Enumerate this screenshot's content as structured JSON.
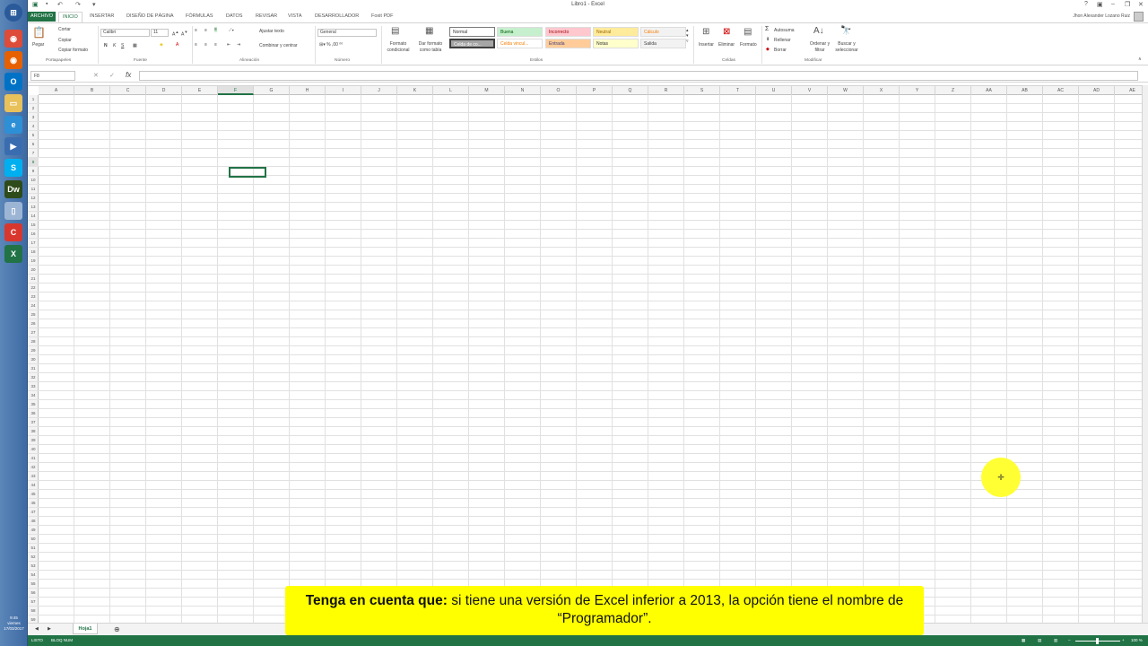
{
  "window": {
    "title": "Libro1 - Excel",
    "user": "Jhon Alexander Lozano Ruiz"
  },
  "tabs": [
    {
      "label": "ARCHIVO"
    },
    {
      "label": "INICIO"
    },
    {
      "label": "INSERTAR"
    },
    {
      "label": "DISEÑO DE PÁGINA"
    },
    {
      "label": "FÓRMULAS"
    },
    {
      "label": "DATOS"
    },
    {
      "label": "REVISAR"
    },
    {
      "label": "VISTA"
    },
    {
      "label": "DESARROLLADOR"
    },
    {
      "label": "Foxit PDF"
    }
  ],
  "ribbon": {
    "clipboard": {
      "paste": "Pegar",
      "cut": "Cortar",
      "copy": "Copiar",
      "format_painter": "Copiar formato",
      "label": "Portapapeles"
    },
    "font": {
      "name": "Calibri",
      "size": "11",
      "bold": "N",
      "italic": "K",
      "underline": "S",
      "label": "Fuente"
    },
    "alignment": {
      "wrap": "Ajustar texto",
      "merge": "Combinar y centrar",
      "label": "Alineación"
    },
    "number": {
      "format": "General",
      "label": "Número"
    },
    "styles": {
      "conditional": "Formato condicional",
      "as_table": "Dar formato como tabla",
      "cells": [
        {
          "label": "Normal",
          "bg": "#ffffff",
          "fg": "#333333"
        },
        {
          "label": "Buena",
          "bg": "#c6efce",
          "fg": "#006100"
        },
        {
          "label": "Incorrecto",
          "bg": "#ffc7ce",
          "fg": "#9c0006"
        },
        {
          "label": "Neutral",
          "bg": "#ffeb9c",
          "fg": "#9c6500"
        },
        {
          "label": "Cálculo",
          "bg": "#f2f2f2",
          "fg": "#fa7d00"
        },
        {
          "label": "Celda de co...",
          "bg": "#a5a5a5",
          "fg": "#ffffff"
        },
        {
          "label": "Celda vincul...",
          "bg": "#ffffff",
          "fg": "#fa7d00"
        },
        {
          "label": "Entrada",
          "bg": "#ffcc99",
          "fg": "#3f3f76"
        },
        {
          "label": "Notas",
          "bg": "#ffffcc",
          "fg": "#333333"
        },
        {
          "label": "Salida",
          "bg": "#f2f2f2",
          "fg": "#3f3f3f"
        }
      ],
      "label": "Estilos"
    },
    "cells_group": {
      "insert": "Insertar",
      "delete": "Eliminar",
      "format": "Formato",
      "label": "Celdas"
    },
    "editing": {
      "autosum": "Autosuma",
      "fill": "Rellenar",
      "clear": "Borrar",
      "sort": "Ordenar y filtrar",
      "find": "Buscar y seleccionar",
      "label": "Modificar"
    }
  },
  "formula_bar": {
    "name_box": "F8",
    "fx": "fx",
    "value": ""
  },
  "columns": [
    "A",
    "B",
    "C",
    "D",
    "E",
    "F",
    "G",
    "H",
    "I",
    "J",
    "K",
    "L",
    "M",
    "N",
    "O",
    "P",
    "Q",
    "R",
    "S",
    "T",
    "U",
    "V",
    "W",
    "X",
    "Y",
    "Z",
    "AA",
    "AB",
    "AC",
    "AD",
    "AE"
  ],
  "selected_cell": "F8",
  "sheet": {
    "name": "Hoja1",
    "add": "⊕"
  },
  "status": {
    "ready": "LISTO",
    "bloq": "BLOQ NUM",
    "zoom": "100 %"
  },
  "clock": {
    "time": "9:45",
    "day": "viernes",
    "date": "17/03/2017"
  },
  "caption": {
    "bold": "Tenga en cuenta que:",
    "text": " si tiene una versión de Excel inferior a 2013, la opción tiene el nombre de “Programador”."
  }
}
